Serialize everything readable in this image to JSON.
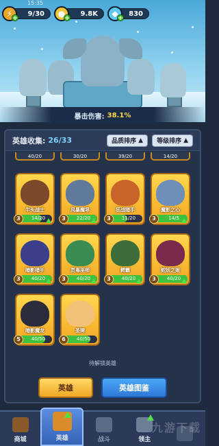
{
  "status": {
    "time": "15:35"
  },
  "resources": {
    "stamina": {
      "value": "9/30",
      "icon": "stamina-icon"
    },
    "gold": {
      "value": "9.8K",
      "icon": "gold-coin-icon"
    },
    "gems": {
      "value": "830",
      "icon": "gem-icon"
    }
  },
  "banner": {
    "crit_label": "暴击伤害:",
    "crit_value": "38.1%"
  },
  "collection": {
    "title": "英雄收集:",
    "count": "26/33",
    "sort_quality": "品质排序",
    "sort_level": "等级排序",
    "partial_row": [
      "40/20",
      "30/20",
      "39/20",
      "14/20"
    ],
    "heroes": [
      {
        "name": "牛头战士",
        "star": "3",
        "level": "14/20",
        "fill": 0.7,
        "color": "#7a4a2a",
        "up": true
      },
      {
        "name": "风暴魔导",
        "star": "3",
        "level": "22/20",
        "fill": 1.0,
        "color": "#5f7a9a",
        "up": true
      },
      {
        "name": "狂战猎手",
        "star": "3",
        "level": "11/20",
        "fill": 0.55,
        "color": "#c8642a",
        "up": false
      },
      {
        "name": "魔影之心",
        "star": "3",
        "level": "14/5",
        "fill": 1.0,
        "color": "#6d8fb8",
        "up": true
      },
      {
        "name": "暗影猎手",
        "star": "3",
        "level": "40/20",
        "fill": 1.0,
        "color": "#3b3f8c",
        "up": true
      },
      {
        "name": "灵毒巫师",
        "star": "3",
        "level": "40/20",
        "fill": 1.0,
        "color": "#3b8c52",
        "up": true
      },
      {
        "name": "鳄霸",
        "star": "3",
        "level": "40/20",
        "fill": 1.0,
        "color": "#3d6e3a",
        "up": true
      },
      {
        "name": "蛇妖之姬",
        "star": "3",
        "level": "40/20",
        "fill": 1.0,
        "color": "#7a2a4a",
        "up": true
      },
      {
        "name": "暗影魔龙",
        "star": "5",
        "level": "40/50",
        "fill": 0.8,
        "color": "#2b2d3a",
        "up": false
      },
      {
        "name": "圣牌",
        "star": "6",
        "level": "40/50",
        "fill": 0.8,
        "color": "#f2c27a",
        "up": false
      }
    ],
    "unlock_note": "待解锁英雄",
    "btn_heroes": "英雄",
    "btn_codex": "英雄图鉴"
  },
  "nav": [
    {
      "label": "商城",
      "icon": "shop-chest-icon",
      "active": false,
      "up": false,
      "locked": false
    },
    {
      "label": "英雄",
      "icon": "hero-card-icon",
      "active": true,
      "up": true,
      "locked": false
    },
    {
      "label": "战斗",
      "icon": "battle-icon",
      "active": false,
      "up": false,
      "locked": true
    },
    {
      "label": "领主",
      "icon": "lord-icon",
      "active": false,
      "up": true,
      "locked": false
    },
    {
      "label": "",
      "icon": "locked-icon",
      "active": false,
      "up": false,
      "locked": true
    }
  ],
  "watermark": "九游下载"
}
